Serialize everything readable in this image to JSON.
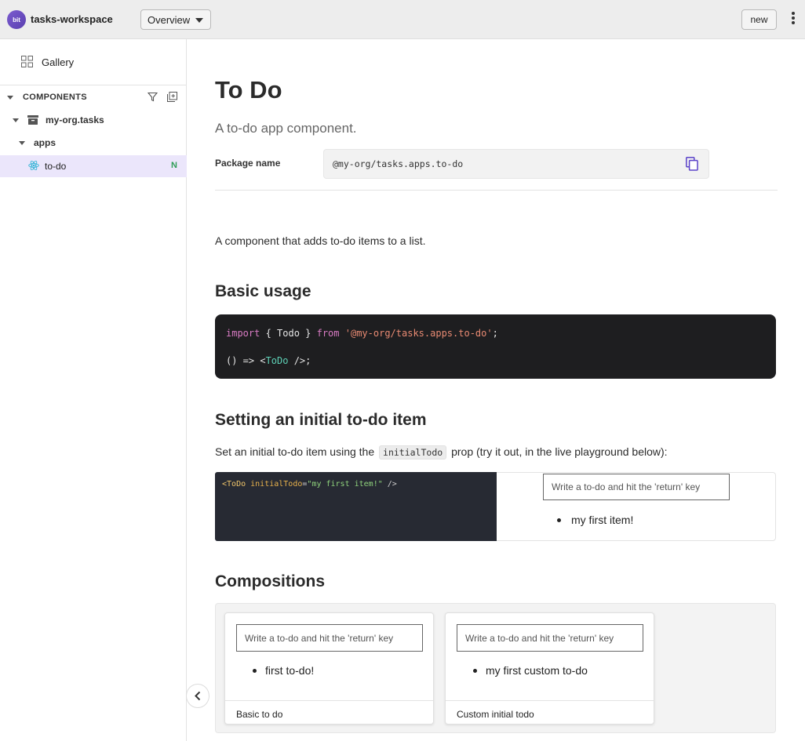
{
  "header": {
    "logo_text": "bit",
    "workspace_name": "tasks-workspace",
    "view_selector": "Overview",
    "new_button": "new"
  },
  "sidebar": {
    "gallery_label": "Gallery",
    "section_label": "COMPONENTS",
    "tree": {
      "scope": "my-org.tasks",
      "namespace": "apps",
      "component": "to-do",
      "component_status": "N"
    }
  },
  "main": {
    "title": "To Do",
    "subtitle": "A to-do app component.",
    "package_label": "Package name",
    "package_name": "@my-org/tasks.apps.to-do",
    "intro": "A component that adds to-do items to a list.",
    "basic_usage_heading": "Basic usage",
    "code": {
      "import_kw": "import",
      "import_mid": " { Todo } ",
      "from_kw": "from",
      "import_path": "'@my-org/tasks.apps.to-do'",
      "semi": ";",
      "line2_pre": "() => <",
      "line2_tag": "ToDo",
      "line2_post": " />;"
    },
    "initial_heading": "Setting an initial to-do item",
    "initial_desc_pre": "Set an initial to-do item using the",
    "initial_desc_code": "initialTodo",
    "initial_desc_post": "prop (try it out, in the live playground below):",
    "playground": {
      "open": "<",
      "tag": "ToDo",
      "attr": " initialTodo",
      "eq": "=",
      "str": "\"my first item!\"",
      "close": " />",
      "input_placeholder": "Write a to-do and hit the 'return' key",
      "item": "my first item!"
    },
    "compositions_heading": "Compositions",
    "compositions": [
      {
        "input_placeholder": "Write a to-do and hit the 'return' key",
        "item": "first to-do!",
        "label": "Basic to do"
      },
      {
        "input_placeholder": "Write a to-do and hit the 'return' key",
        "item": "my first custom to-do",
        "label": "Custom initial todo"
      }
    ]
  },
  "colors": {
    "accent": "#6c4fc6",
    "selected_bg": "#ebe6fb",
    "new_status": "#2e9e57",
    "code_bg": "#1e1e20"
  }
}
